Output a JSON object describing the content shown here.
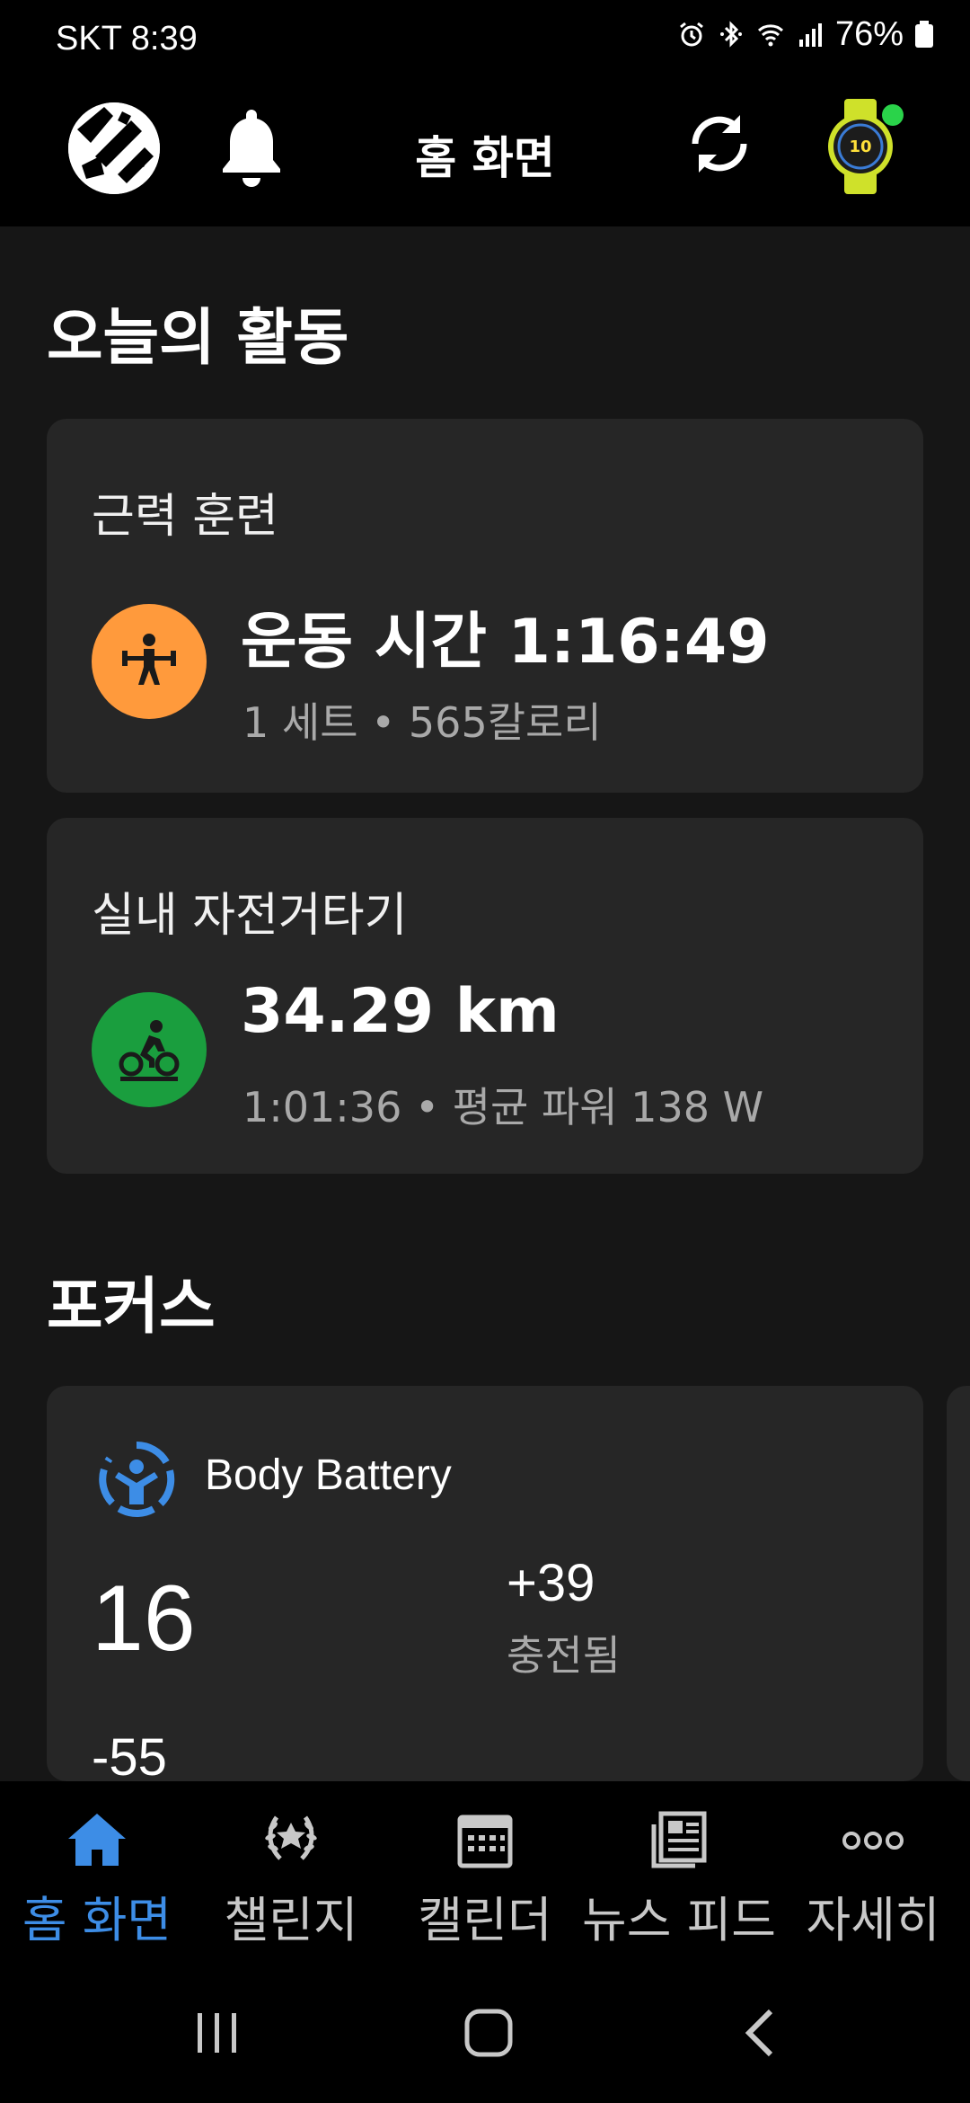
{
  "status_bar": {
    "carrier_time": "SKT 8:39",
    "battery": "76%"
  },
  "header": {
    "title": "홈 화면",
    "device_connected_color": "#2ad34a"
  },
  "today": {
    "section_title": "오늘의 활동",
    "activities": [
      {
        "label": "근력 훈련",
        "main": "운동 시간 1:16:49",
        "sub": "1 세트 • 565칼로리",
        "icon": "weightlifting-icon",
        "color": "#ff9a3c"
      },
      {
        "label": "실내 자전거타기",
        "main": "34.29 km",
        "sub": "1:01:36 • 평균 파워 138 W",
        "icon": "indoor-cycling-icon",
        "color": "#1a9e3e"
      }
    ]
  },
  "focus": {
    "section_title": "포커스",
    "body_battery": {
      "label": "Body Battery",
      "value": "16",
      "charged": "+39",
      "charged_label": "충전됨",
      "drained": "-55",
      "icon_color": "#3d8de6"
    }
  },
  "bottom_nav": {
    "items": [
      {
        "label": "홈 화면",
        "icon": "home-icon",
        "active": true
      },
      {
        "label": "챌린지",
        "icon": "laurel-icon",
        "active": false
      },
      {
        "label": "캘린더",
        "icon": "calendar-icon",
        "active": false
      },
      {
        "label": "뉴스 피드",
        "icon": "newsfeed-icon",
        "active": false
      },
      {
        "label": "자세히",
        "icon": "more-icon",
        "active": false
      }
    ]
  }
}
